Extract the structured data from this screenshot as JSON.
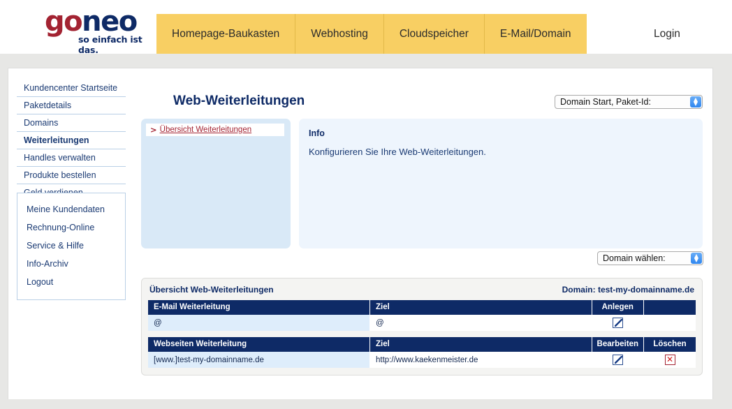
{
  "brand": {
    "logo_go": "go",
    "logo_neo": "neo",
    "tagline": "so einfach ist das.",
    "accent_yellow": "#f8cf63",
    "accent_navy": "#0e2a66",
    "accent_red": "#a32332"
  },
  "nav": {
    "items": [
      {
        "label": "Homepage-Baukasten"
      },
      {
        "label": "Webhosting"
      },
      {
        "label": "Cloudspeicher"
      },
      {
        "label": "E-Mail/Domain"
      }
    ],
    "login_label": "Login"
  },
  "sidebar": {
    "primary": [
      {
        "label": "Kundencenter Startseite",
        "active": false
      },
      {
        "label": "Paketdetails",
        "active": false
      },
      {
        "label": "Domains",
        "active": false
      },
      {
        "label": "Weiterleitungen",
        "active": true
      },
      {
        "label": "Handles verwalten",
        "active": false
      },
      {
        "label": "Produkte bestellen",
        "active": false
      },
      {
        "label": "Geld verdienen",
        "active": false
      }
    ],
    "secondary": [
      {
        "label": "Meine Kundendaten"
      },
      {
        "label": "Rechnung-Online"
      },
      {
        "label": "Service & Hilfe"
      },
      {
        "label": "Info-Archiv"
      },
      {
        "label": "Logout"
      }
    ]
  },
  "main": {
    "page_title": "Web-Weiterleitungen",
    "paket_select": {
      "value": "Domain Start, Paket-Id:",
      "options": [
        "Domain Start, Paket-Id:"
      ]
    },
    "domain_select": {
      "value": "Domain wählen:",
      "options": [
        "Domain wählen:"
      ]
    },
    "nav_panel": {
      "chevron": ">",
      "link_label": "Übersicht Weiterleitungen"
    },
    "info_panel": {
      "heading": "Info",
      "text": "Konfigurieren Sie Ihre Web-Weiterleitungen."
    },
    "overview": {
      "title": "Übersicht Web-Weiterleitungen",
      "domain_label": "Domain: test-my-domainname.de",
      "email_table": {
        "headers": [
          "E-Mail Weiterleitung",
          "Ziel",
          "Anlegen",
          ""
        ],
        "rows": [
          {
            "source": "@",
            "target": "@",
            "create_icon": "wrench-edit-icon",
            "extra": ""
          }
        ]
      },
      "web_table": {
        "headers": [
          "Webseiten Weiterleitung",
          "Ziel",
          "Bearbeiten",
          "Löschen"
        ],
        "rows": [
          {
            "source": "[www.]test-my-domainname.de",
            "target": "http://www.kaekenmeister.de",
            "edit_icon": "wrench-edit-icon",
            "delete_icon": "red-x-delete-icon",
            "delete_glyph": "✕"
          }
        ]
      }
    }
  }
}
